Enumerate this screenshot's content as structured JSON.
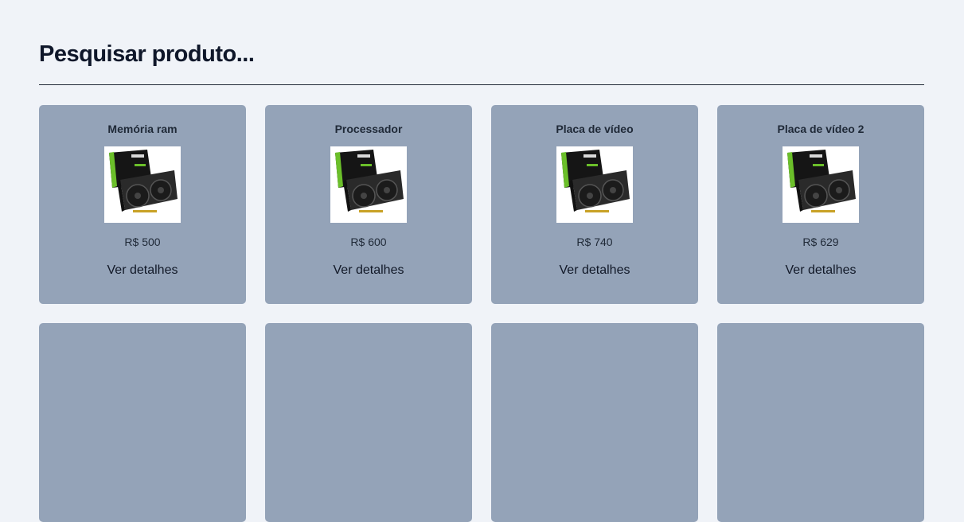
{
  "header": {
    "title": "Pesquisar produto..."
  },
  "products": [
    {
      "name": "Memória ram",
      "price": "R$ 500",
      "link_label": "Ver detalhes",
      "image_icon": "graphics-card-icon"
    },
    {
      "name": "Processador",
      "price": "R$ 600",
      "link_label": "Ver detalhes",
      "image_icon": "graphics-card-icon"
    },
    {
      "name": "Placa de vídeo",
      "price": "R$ 740",
      "link_label": "Ver detalhes",
      "image_icon": "graphics-card-icon"
    },
    {
      "name": "Placa de vídeo 2",
      "price": "R$ 629",
      "link_label": "Ver detalhes",
      "image_icon": "graphics-card-icon"
    }
  ],
  "colors": {
    "background": "#f0f3f8",
    "card": "#94a3b8",
    "text": "#111827",
    "gpu_box_green": "#6bbf2a"
  }
}
